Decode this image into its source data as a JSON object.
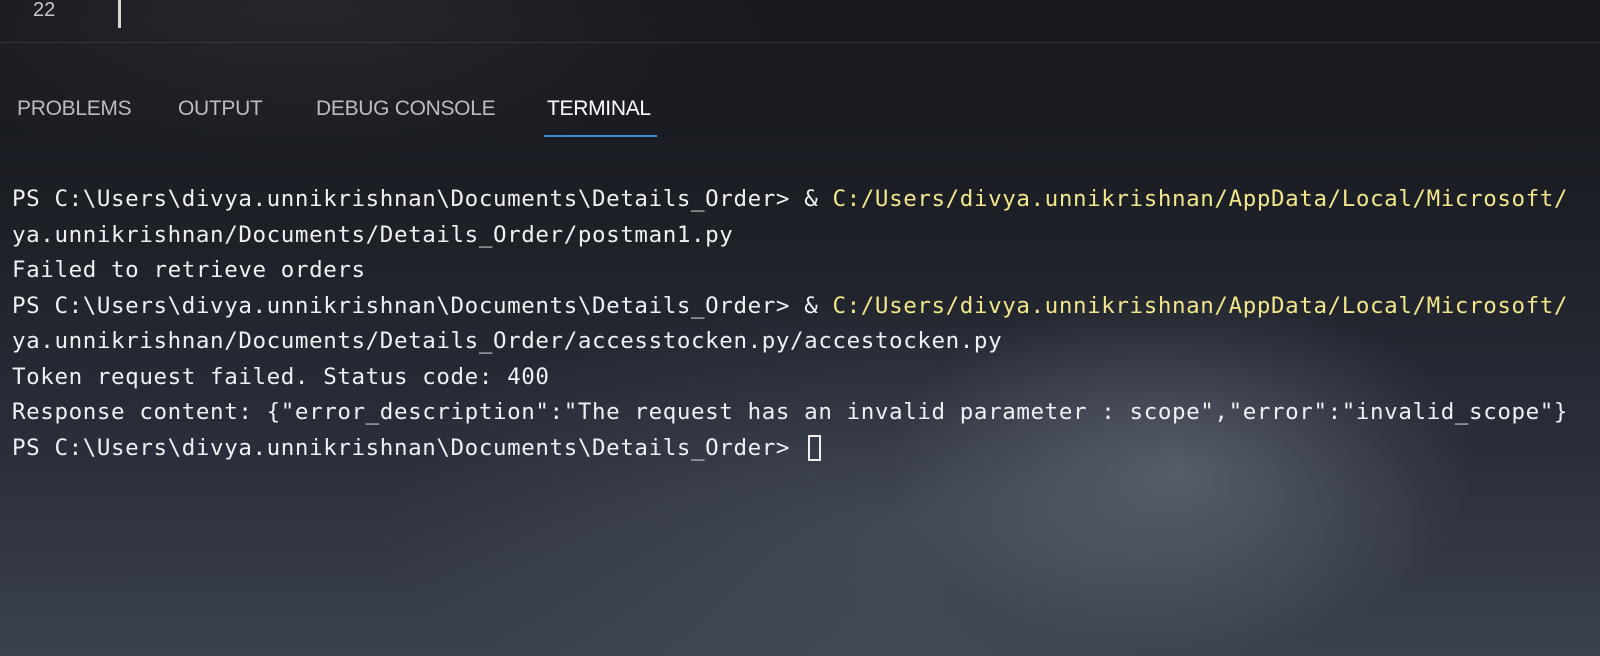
{
  "editor": {
    "line_number": "22"
  },
  "panel": {
    "tabs": [
      {
        "label": "PROBLEMS",
        "active": false
      },
      {
        "label": "OUTPUT",
        "active": false
      },
      {
        "label": "DEBUG CONSOLE",
        "active": false
      },
      {
        "label": "TERMINAL",
        "active": true
      }
    ],
    "active_tab_color": "#3b8fd6"
  },
  "terminal": {
    "lines": [
      {
        "prompt": "PS C:\\Users\\divya.unnikrishnan\\Documents\\Details_Order> ",
        "amp": "& ",
        "path": "C:/Users/divya.unnikrishnan/AppData/Local/Microsoft/"
      },
      {
        "text": "ya.unnikrishnan/Documents/Details_Order/postman1.py"
      },
      {
        "text": "Failed to retrieve orders"
      },
      {
        "prompt": "PS C:\\Users\\divya.unnikrishnan\\Documents\\Details_Order> ",
        "amp": "& ",
        "path": "C:/Users/divya.unnikrishnan/AppData/Local/Microsoft/"
      },
      {
        "text": "ya.unnikrishnan/Documents/Details_Order/accesstocken.py/accestocken.py"
      },
      {
        "text": "Token request failed. Status code: 400"
      },
      {
        "text": "Response content: {\"error_description\":\"The request has an invalid parameter : scope\",\"error\":\"invalid_scope\"}"
      },
      {
        "prompt": "PS C:\\Users\\divya.unnikrishnan\\Documents\\Details_Order> "
      }
    ],
    "path_color": "#f3e58a"
  }
}
